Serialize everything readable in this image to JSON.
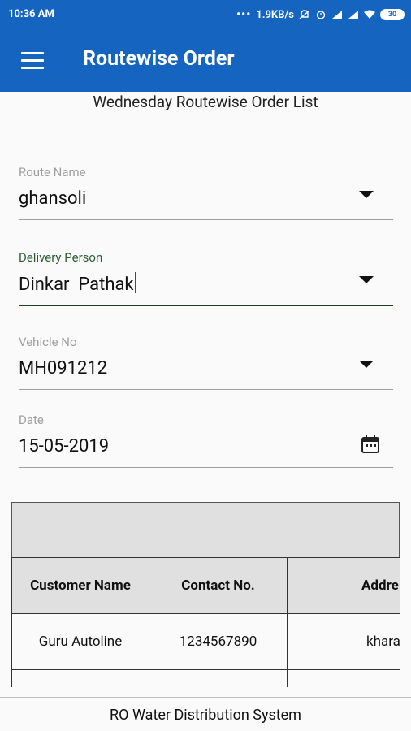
{
  "status_bar": {
    "time": "10:36 AM",
    "network_speed": "1.9KB/s",
    "battery": "30",
    "icons": [
      "more-dots-icon",
      "mute-icon",
      "alarm-icon",
      "signal-icon",
      "signal-icon",
      "wifi-icon",
      "battery-icon"
    ]
  },
  "app_bar": {
    "title": "Routewise Order",
    "menu_icon": "hamburger-menu-icon"
  },
  "subtitle": "Wednesday Routewise Order List",
  "form": {
    "route": {
      "label": "Route Name",
      "value": "ghansoli"
    },
    "delivery": {
      "label": "Delivery Person",
      "value": "Dinkar  Pathak"
    },
    "vehicle": {
      "label": "Vehicle No",
      "value": "MH091212"
    },
    "date": {
      "label": "Date",
      "value": "15-05-2019",
      "icon": "calendar-icon"
    }
  },
  "table": {
    "columns": [
      "Customer Name",
      "Contact No.",
      "Addre"
    ],
    "rows": [
      [
        "Guru Autoline",
        "1234567890",
        "khara"
      ]
    ]
  },
  "footer": "RO Water Distribution System",
  "colors": {
    "primary": "#1565c0",
    "focus": "#2e5d34",
    "table_header": "#e0e0e0"
  }
}
